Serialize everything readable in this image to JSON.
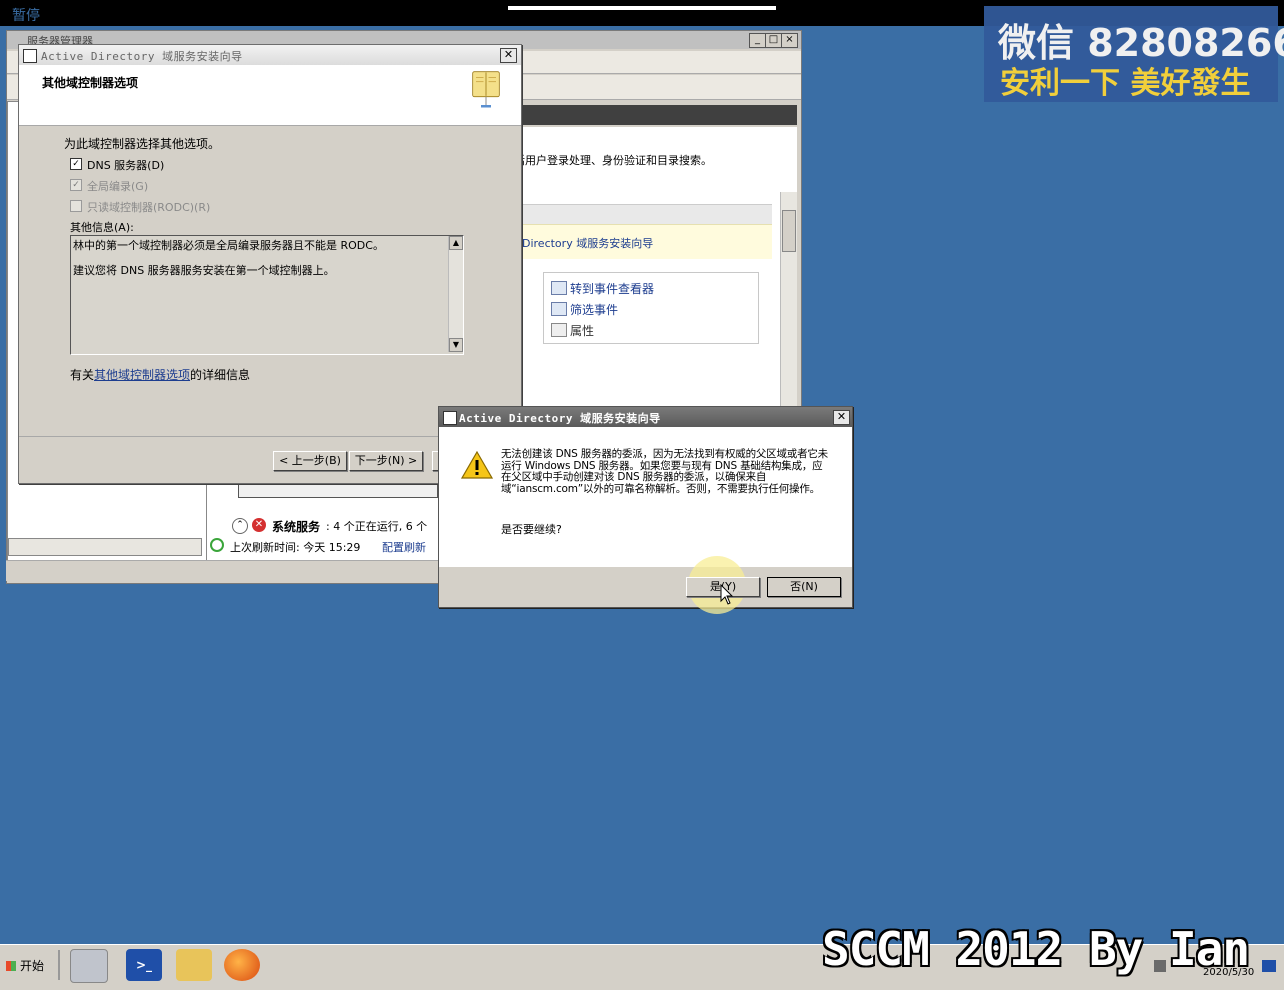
{
  "top_bar": {
    "pause_label": "暂停"
  },
  "watermark": {
    "line1": "微信 82808266",
    "line2": "安利一下 美好發生"
  },
  "server_manager": {
    "title": "服务器管理器",
    "description_fragment": "活用户登录处理、身份验证和目录搜索。",
    "ad_link_fragment": "Directory 域服务安装向导",
    "actions": [
      "转到事件查看器",
      "筛选事件",
      "属性"
    ],
    "system_services_label": "系统服务",
    "system_services_status": ": 4 个正在运行, 6 个",
    "last_refresh_label": "上次刷新时间: 今天 15:29",
    "configure_refresh_link": "配置刷新"
  },
  "wizard": {
    "title": "Active Directory 域服务安装向导",
    "header_title": "其他域控制器选项",
    "intro": "为此域控制器选择其他选项。",
    "options": [
      {
        "label": "DNS 服务器(D)",
        "checked": true,
        "enabled": true
      },
      {
        "label": "全局编录(G)",
        "checked": true,
        "enabled": false
      },
      {
        "label": "只读域控制器(RODC)(R)",
        "checked": false,
        "enabled": false
      }
    ],
    "more_info_label": "其他信息(A):",
    "more_info_lines": [
      "林中的第一个域控制器必须是全局编录服务器且不能是 RODC。",
      "建议您将 DNS 服务器服务安装在第一个域控制器上。"
    ],
    "details_prefix": "有关",
    "details_link": "其他域控制器选项",
    "details_suffix": "的详细信息",
    "back_button": "< 上一步(B)",
    "next_button": "下一步(N) >"
  },
  "dialog": {
    "title": "Active Directory 域服务安装向导",
    "message": "无法创建该 DNS 服务器的委派，因为无法找到有权威的父区域或者它未运行 Windows DNS 服务器。如果您要与现有 DNS 基础结构集成，应在父区域中手动创建对该 DNS 服务器的委派，以确保来自域“ianscm.com”以外的可靠名称解析。否则，不需要执行任何操作。",
    "question": "是否要继续?",
    "yes_button": "是(Y)",
    "no_button": "否(N)"
  },
  "taskbar": {
    "start_label": "开始",
    "overlay_text": "SCCM 2012 By Ian",
    "date": "2020/5/30"
  }
}
